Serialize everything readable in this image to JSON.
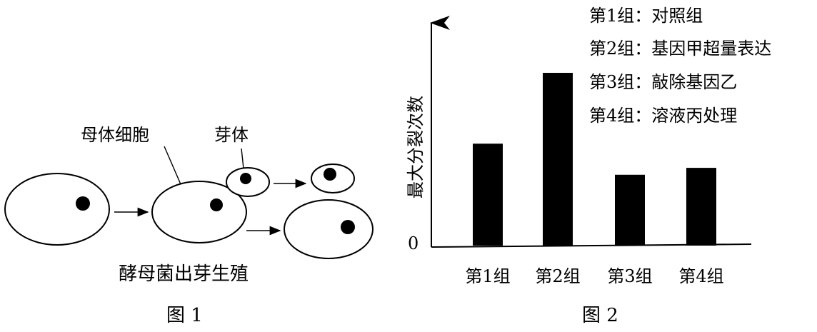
{
  "figure1": {
    "labels": {
      "mother_cell": "母体细胞",
      "bud": "芽体",
      "caption": "酵母菌出芽生殖"
    },
    "figure_label": "图 1"
  },
  "figure2": {
    "figure_label": "图 2",
    "legend": [
      "第1组：对照组",
      "第2组：基因甲超量表达",
      "第3组：敲除基因乙",
      "第4组：溶液丙处理"
    ],
    "ylabel": "最大分裂次数",
    "zero_label": "0"
  },
  "chart_data": {
    "type": "bar",
    "title": "",
    "xlabel": "",
    "ylabel": "最大分裂次数",
    "categories": [
      "第1组",
      "第2组",
      "第3组",
      "第4组"
    ],
    "values": [
      0.59,
      1.0,
      0.41,
      0.45
    ],
    "ylim": [
      0,
      1.2
    ],
    "grid": false,
    "legend_position": "top-right"
  }
}
